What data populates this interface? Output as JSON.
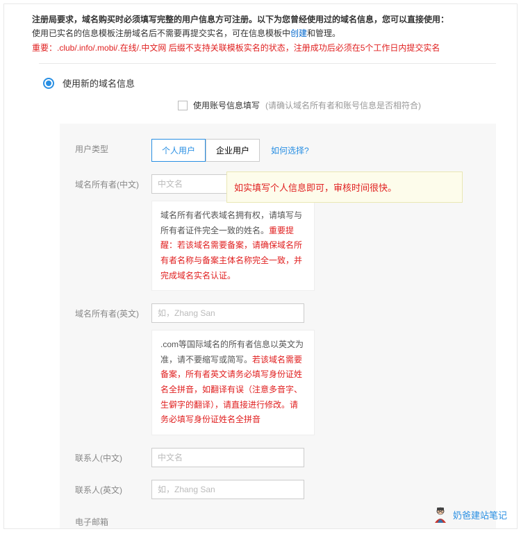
{
  "header": {
    "line1": "注册局要求，域名购买时必须填写完整的用户信息方可注册。以下为您曾经使用过的域名信息，您可以直接使用：",
    "line2_pre": "使用已实名的信息模板注册域名后不需要再提交实名，可在信息模板中",
    "line2_link": "创建",
    "line2_post": "和管理。",
    "line3": "重要：.club/.info/.mobi/.在线/.中文网 后缀不支持关联模板实名的状态，注册成功后必须在5个工作日内提交实名"
  },
  "radio": {
    "label": "使用新的域名信息"
  },
  "subOption": {
    "label": "使用账号信息填写",
    "hint": "(请确认域名所有者和账号信息是否相符合)"
  },
  "tip": {
    "text": "如实填写个人信息即可，审核时间很快。"
  },
  "form": {
    "userType": {
      "label": "用户类型",
      "tab1": "个人用户",
      "tab2": "企业用户",
      "help": "如何选择?"
    },
    "ownerCn": {
      "label": "域名所有者(中文)",
      "placeholder": "中文名",
      "hint_black": "域名所有者代表域名拥有权，请填写与所有者证件完全一致的姓名。",
      "hint_red": "重要提醒：若该域名需要备案，请确保域名所有者名称与备案主体名称完全一致，并完成域名实名认证。"
    },
    "ownerEn": {
      "label": "域名所有者(英文)",
      "placeholder": "如，Zhang San",
      "hint_black": ".com等国际域名的所有者信息以英文为准，请不要缩写或简写。",
      "hint_red": "若该域名需要备案，所有者英文请务必填写身份证姓名全拼音，如翻译有误（注意多音字、生僻字的翻译），请直接进行修改。请务必填写身份证姓名全拼音"
    },
    "contactCn": {
      "label": "联系人(中文)",
      "placeholder": "中文名"
    },
    "contactEn": {
      "label": "联系人(英文)",
      "placeholder": "如，Zhang San"
    },
    "email": {
      "label": "电子邮箱"
    }
  },
  "watermark": {
    "text": "奶爸建站笔记"
  }
}
